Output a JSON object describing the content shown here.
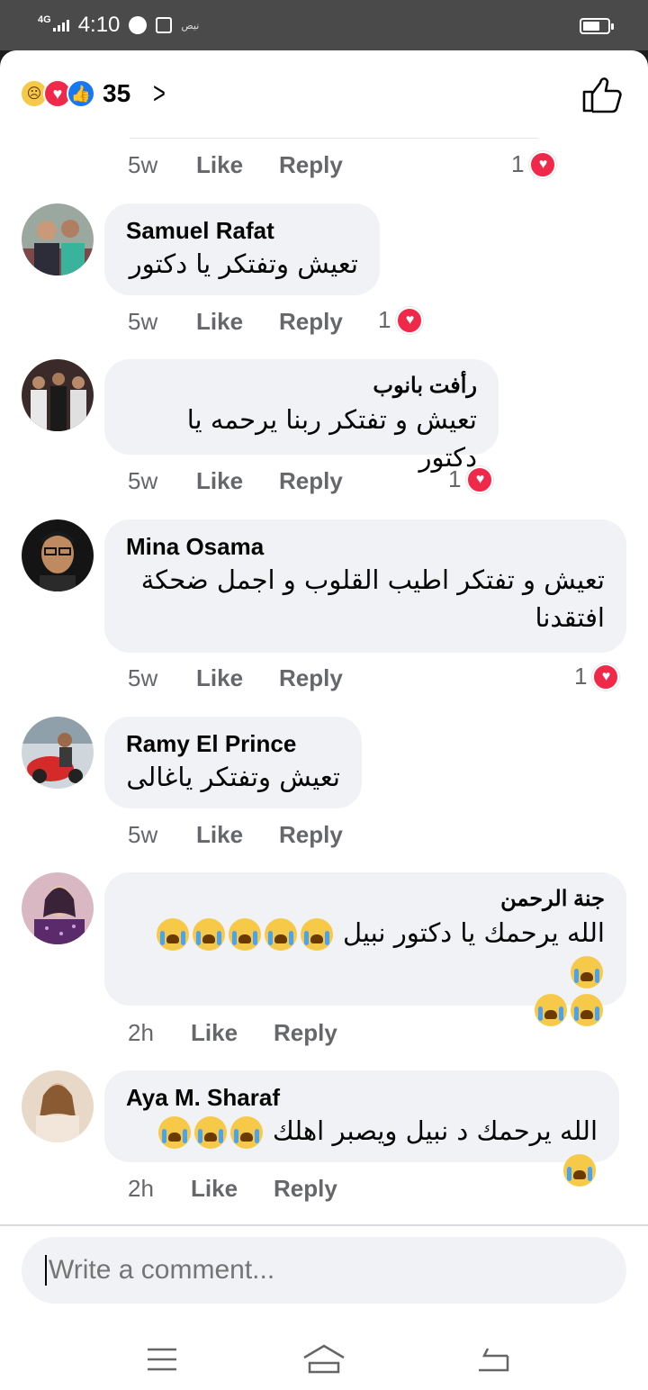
{
  "status_bar": {
    "network": "4G",
    "time": "4:10",
    "extra": "نيص"
  },
  "reactions": {
    "count": "35",
    "types": [
      "sad-icon",
      "love-icon",
      "like-icon"
    ]
  },
  "top_meta": {
    "time": "5w",
    "like": "Like",
    "reply": "Reply",
    "reaction_count": "1"
  },
  "comments": [
    {
      "name": "Samuel Rafat",
      "text": "تعيش وتفتكر يا دكتور",
      "time": "5w",
      "like": "Like",
      "reply": "Reply",
      "reaction_count": "1"
    },
    {
      "name": "رأفت بانوب",
      "text": "تعيش و تفتكر ربنا يرحمه يا دكتور",
      "time": "5w",
      "like": "Like",
      "reply": "Reply",
      "reaction_count": "1"
    },
    {
      "name": "Mina Osama",
      "text_line1": "تعيش و تفتكر اطيب القلوب و اجمل ضحكة",
      "text_line2": "افتقدنا",
      "time": "5w",
      "like": "Like",
      "reply": "Reply",
      "reaction_count": "1"
    },
    {
      "name": "Ramy El Prince",
      "text": "تعيش وتفتكر ياغالى",
      "time": "5w",
      "like": "Like",
      "reply": "Reply"
    },
    {
      "name": "جنة الرحمن",
      "text": "الله يرحمك يا دكتور نبيل",
      "emoji_count_line1": 6,
      "emoji_count_line2": 2,
      "emoji": "crying-face-icon",
      "time": "2h",
      "like": "Like",
      "reply": "Reply"
    },
    {
      "name": "Aya M. Sharaf",
      "text": "الله يرحمك د نبيل ويصبر اهلك",
      "emoji_count": 4,
      "emoji": "crying-face-icon",
      "time": "2h",
      "like": "Like",
      "reply": "Reply"
    }
  ],
  "composer": {
    "placeholder": "Write a comment..."
  },
  "colors": {
    "bubble": "#f0f2f5",
    "meta": "#65676b",
    "love": "#f0284a",
    "like": "#1877f2",
    "sad": "#f7c948"
  }
}
